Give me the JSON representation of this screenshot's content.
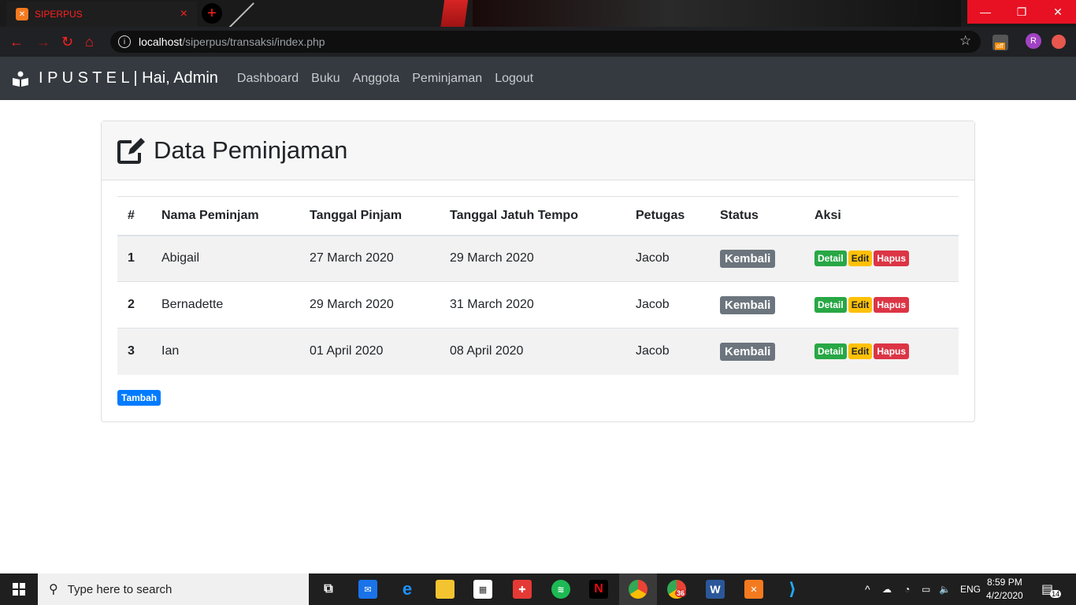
{
  "browser": {
    "tab_title": "SIPERPUS",
    "url_host": "localhost",
    "url_path": "/siperpus/transaksi/index.php",
    "profile_initial": "R",
    "ext_badge": "off"
  },
  "navbar": {
    "brand": "I P U S T E L | Hai, Admin",
    "links": [
      "Dashboard",
      "Buku",
      "Anggota",
      "Peminjaman",
      "Logout"
    ]
  },
  "page": {
    "title": "Data Peminjaman",
    "add_button": "Tambah"
  },
  "table": {
    "headers": [
      "#",
      "Nama Peminjam",
      "Tanggal Pinjam",
      "Tanggal Jatuh Tempo",
      "Petugas",
      "Status",
      "Aksi"
    ],
    "rows": [
      {
        "no": "1",
        "nama": "Abigail",
        "pinjam": "27 March 2020",
        "tempo": "29 March 2020",
        "petugas": "Jacob",
        "status": "Kembali"
      },
      {
        "no": "2",
        "nama": "Bernadette",
        "pinjam": "29 March 2020",
        "tempo": "31 March 2020",
        "petugas": "Jacob",
        "status": "Kembali"
      },
      {
        "no": "3",
        "nama": "Ian",
        "pinjam": "01 April 2020",
        "tempo": "08 April 2020",
        "petugas": "Jacob",
        "status": "Kembali"
      }
    ],
    "actions": {
      "detail": "Detail",
      "edit": "Edit",
      "hapus": "Hapus"
    }
  },
  "taskbar": {
    "search_placeholder": "Type here to search",
    "chrome_badge": "36",
    "lang": "ENG",
    "time": "8:59 PM",
    "date": "4/2/2020",
    "notifications": "14"
  },
  "colors": {
    "navbar_bg": "#343a40",
    "detail": "#28a745",
    "edit": "#ffc107",
    "hapus": "#dc3545",
    "status": "#6c757d",
    "primary": "#007bff"
  }
}
